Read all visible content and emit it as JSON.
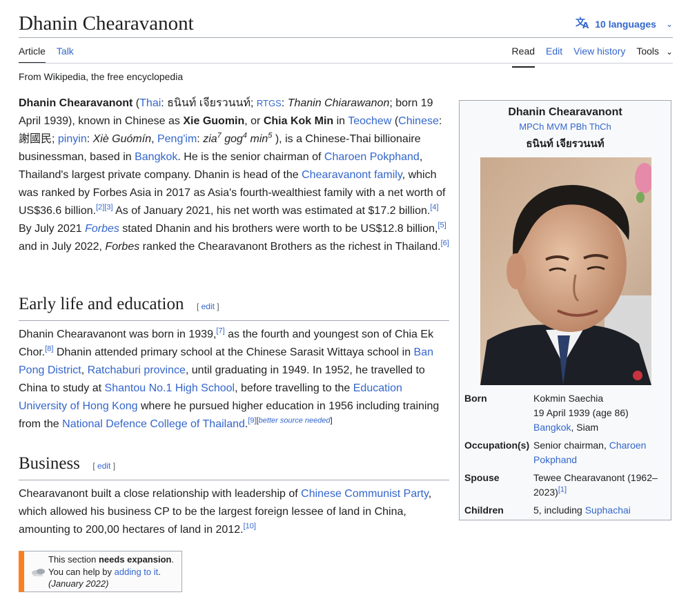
{
  "page": {
    "title": "Dhanin Chearavanont",
    "tagline": "From Wikipedia, the free encyclopedia"
  },
  "languages": {
    "icon": "translate-icon",
    "label": "10 languages"
  },
  "tabs": {
    "left": [
      "Article",
      "Talk"
    ],
    "right": [
      "Read",
      "Edit",
      "View history",
      "Tools"
    ]
  },
  "lead": {
    "name_bold": "Dhanin Chearavanont",
    "thai_link": "Thai",
    "thai_name": "ธนินท์ เจียรวนนท์",
    "rtgs_link": "RTGS",
    "rtgs_name": "Thanin Chiarawanon",
    "born": "; born 19 April 1939), known in Chinese as ",
    "xie": "Xie Guomin",
    "or": ", or ",
    "chia": "Chia Kok Min",
    "in": " in ",
    "teochew": "Teochew",
    "chinese": "Chinese",
    "hanzi": "謝國民",
    "pinyin": "pinyin",
    "pinyin_val": "Xiè Guómín",
    "pengim": "Peng'im",
    "pengim_val1": "zia",
    "pengim_sup1": "7",
    "pengim_val2": "gog",
    "pengim_sup2": "4",
    "pengim_val3": "min",
    "pengim_sup3": "5",
    "t1": " ), is a Chinese-Thai billionaire businessman, based in ",
    "bangkok": "Bangkok",
    "t2": ". He is the senior chairman of ",
    "cp": "Charoen Pokphand",
    "t3": ", Thailand's largest private company. Dhanin is head of the ",
    "family": "Chearavanont family",
    "t4": ", which was ranked by Forbes Asia in 2017 as Asia's fourth-wealthiest family with a net worth of US$36.6 billion.",
    "ref2": "[2]",
    "ref3": "[3]",
    "t5": " As of January 2021, his net worth was estimated at $17.2 billion.",
    "ref4": "[4]",
    "t6": " By July 2021 ",
    "forbes1": "Forbes",
    "t7": " stated Dhanin and his brothers were worth to be US$12.8 billion,",
    "ref5": "[5]",
    "t8": " and in July 2022, ",
    "forbes2": "Forbes",
    "t9": " ranked the Chearavanont Brothers as the richest in Thailand.",
    "ref6": "[6]"
  },
  "early": {
    "heading": "Early life and education",
    "edit": "edit",
    "t1": "Dhanin Chearavanont was born in 1939,",
    "ref7": "[7]",
    "t2": " as the fourth and youngest son of Chia Ek Chor.",
    "ref8": "[8]",
    "t3": " Dhanin attended primary school at the Chinese Sarasit Wittaya school in ",
    "banpong": "Ban Pong District",
    "comma": ", ",
    "ratchaburi": "Ratchaburi province",
    "t4": ", until graduating in 1949. In 1952, he travelled to China to study at ",
    "shantou": "Shantou No.1 High School",
    "t5": ", before travelling to the ",
    "eduhk": "Education University of Hong Kong",
    "t6": " where he pursued higher education in 1956 including training from the ",
    "ndc": "National Defence College of Thailand",
    "t7": ".",
    "ref9": "[9]",
    "better": "better source needed"
  },
  "business": {
    "heading": "Business",
    "edit": "edit",
    "t1": "Chearavanont built a close relationship with leadership of ",
    "ccp": "Chinese Communist Party",
    "t2": ", which allowed his business CP to be the largest foreign lessee of land in China, amounting to 200,00 hectares of land in 2012.",
    "ref10": "[10]"
  },
  "expansion": {
    "t1": "This section ",
    "needs": "needs expansion",
    "t2": ". You can help by ",
    "link": "adding to it",
    "t3": ".",
    "date": " (January 2022)"
  },
  "infobox": {
    "name": "Dhanin Chearavanont",
    "postnominals": "MPCh MVM PBh ThCh",
    "native_name": "ธนินท์ เจียรวนนท์",
    "born_label": "Born",
    "born_name": "Kokmin Saechia",
    "born_date": "19 April 1939 (age 86)",
    "born_place_link": "Bangkok",
    "born_place_rest": ", Siam",
    "occupation_label": "Occupation(s)",
    "occupation_text": "Senior chairman, ",
    "occupation_link": "Charoen Pokphand",
    "spouse_label": "Spouse",
    "spouse_text": "Tewee Chearavanont (1962–2023)",
    "spouse_ref": "[1]",
    "children_label": "Children",
    "children_text": "5, including ",
    "children_link": "Suphachai"
  },
  "colors": {
    "link": "#3366cc",
    "text": "#202122",
    "infobox_bg": "#f8f9fa",
    "expansion_bar": "#fc7f1e"
  }
}
